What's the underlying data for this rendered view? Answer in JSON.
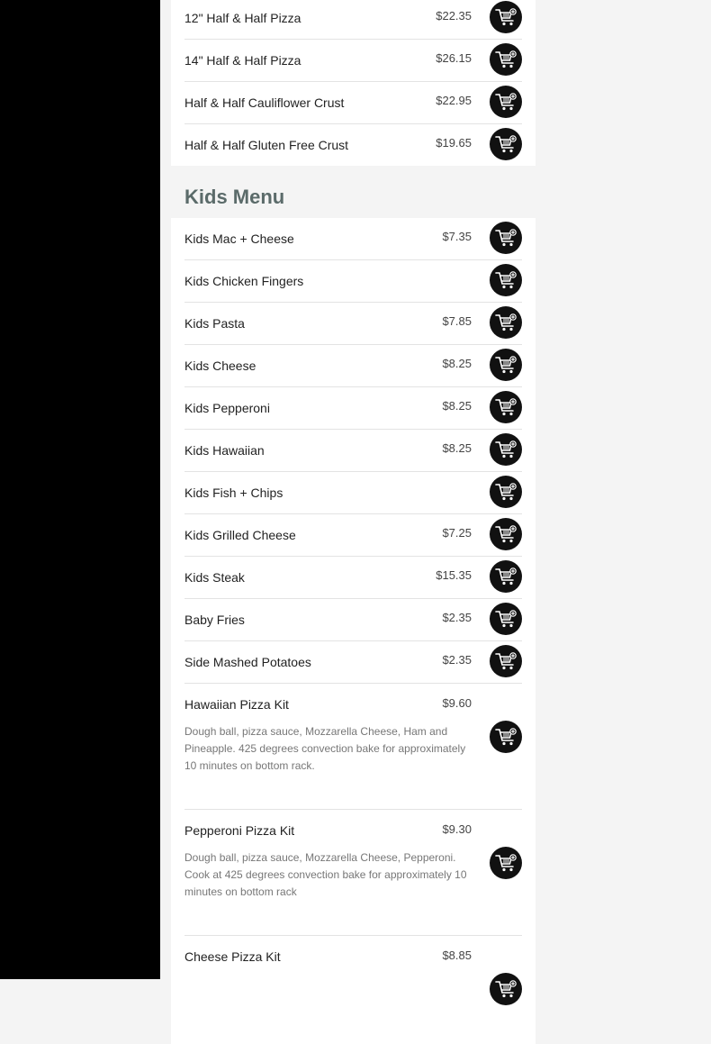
{
  "pizza_section": {
    "items": [
      {
        "name": "12\" Half & Half Pizza",
        "price": "$22.35"
      },
      {
        "name": "14\" Half & Half Pizza",
        "price": "$26.15"
      },
      {
        "name": "Half & Half Cauliflower Crust",
        "price": "$22.95"
      },
      {
        "name": "Half & Half Gluten Free Crust",
        "price": "$19.65"
      }
    ]
  },
  "kids_section": {
    "title": "Kids Menu",
    "items": [
      {
        "name": "Kids Mac + Cheese",
        "price": "$7.35"
      },
      {
        "name": "Kids Chicken Fingers",
        "price": ""
      },
      {
        "name": "Kids Pasta",
        "price": "$7.85"
      },
      {
        "name": "Kids Cheese",
        "price": "$8.25"
      },
      {
        "name": "Kids Pepperoni",
        "price": "$8.25"
      },
      {
        "name": "Kids Hawaiian",
        "price": "$8.25"
      },
      {
        "name": "Kids Fish + Chips",
        "price": ""
      },
      {
        "name": "Kids Grilled Cheese",
        "price": "$7.25"
      },
      {
        "name": "Kids Steak",
        "price": "$15.35"
      },
      {
        "name": "Baby Fries",
        "price": "$2.35"
      },
      {
        "name": "Side Mashed Potatoes",
        "price": "$2.35"
      }
    ],
    "kits": [
      {
        "name": "Hawaiian Pizza Kit",
        "price": "$9.60",
        "description": "Dough ball, pizza sauce, Mozzarella Cheese, Ham and Pineapple. 425 degrees convection bake for approximately 10 minutes on bottom rack."
      },
      {
        "name": "Pepperoni Pizza Kit",
        "price": "$9.30",
        "description": "Dough ball, pizza sauce, Mozzarella Cheese, Pepperoni. Cook at 425 degrees convection bake for approximately 10 minutes on bottom rack"
      },
      {
        "name": "Cheese Pizza Kit",
        "price": "$8.85",
        "description": ""
      }
    ]
  },
  "icons": {
    "add_to_cart": "cart-plus-icon"
  },
  "colors": {
    "sidebar": "#000000",
    "button": "#111111",
    "section_title": "#5b6b6a"
  }
}
